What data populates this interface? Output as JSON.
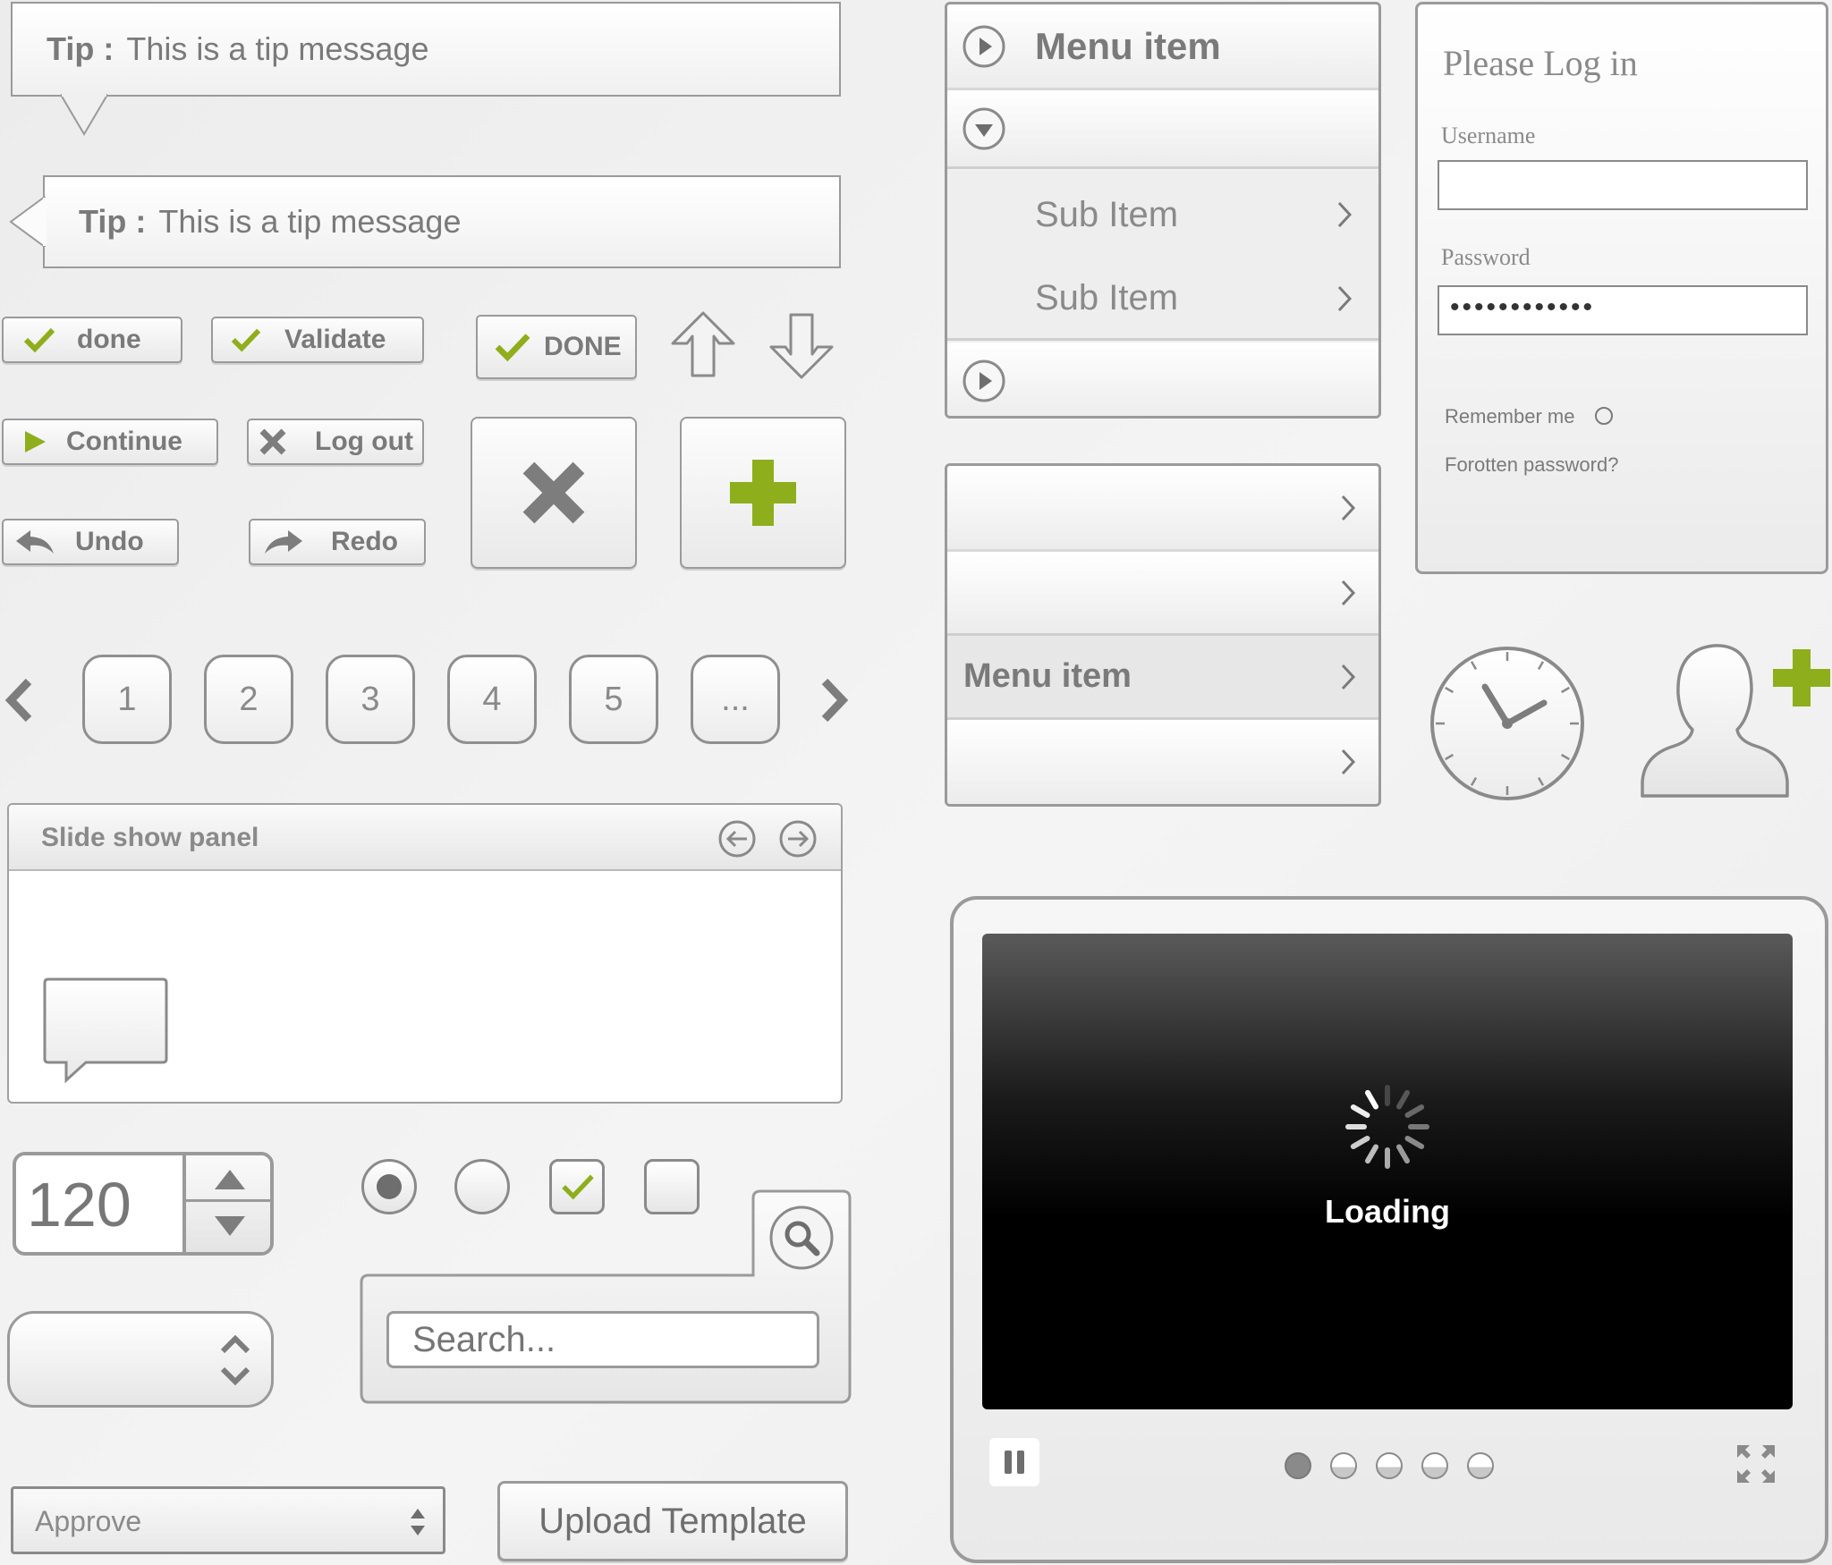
{
  "tips": [
    {
      "label": "Tip :",
      "message": "This is a tip message"
    },
    {
      "label": "Tip :",
      "message": "This is a tip message"
    }
  ],
  "buttons": {
    "done": "done",
    "validate": "Validate",
    "done_caps": "DONE",
    "continue": "Continue",
    "logout": "Log out",
    "undo": "Undo",
    "redo": "Redo"
  },
  "pagination": {
    "pages": [
      "1",
      "2",
      "3",
      "4",
      "5",
      "..."
    ]
  },
  "slideshow": {
    "title": "Slide show panel"
  },
  "stepper": {
    "value": "120"
  },
  "search": {
    "placeholder": "Search..."
  },
  "select": {
    "value": "Approve"
  },
  "upload": {
    "label": "Upload Template"
  },
  "menu1": {
    "header": "Menu item",
    "sub_items": [
      "Sub Item",
      "Sub Item"
    ]
  },
  "menu2": {
    "highlighted": "Menu item"
  },
  "login": {
    "title": "Please Log in",
    "username_label": "Username",
    "username_value": "",
    "password_label": "Password",
    "password_value": "••••••••••••",
    "remember_label": "Remember me",
    "forgot_label": "Forotten password?"
  },
  "player": {
    "loading_label": "Loading",
    "slides_total": 5,
    "slide_active": 1
  },
  "colors": {
    "accent_green": "#8fae1b",
    "border_gray": "#9a9a9a",
    "text_gray": "#7a7a7a",
    "icon_gray": "#7d7d7d"
  },
  "icons": {
    "check": "check-icon",
    "play": "play-icon",
    "close": "close-icon",
    "undo": "undo-arrow-icon",
    "redo": "redo-arrow-icon",
    "up": "arrow-up-icon",
    "down": "arrow-down-icon",
    "remove": "big-x-icon",
    "add": "big-plus-icon",
    "search": "search-icon",
    "clock": "clock-icon",
    "user_add": "user-add-icon",
    "pause": "pause-icon",
    "fullscreen": "fullscreen-icon"
  }
}
